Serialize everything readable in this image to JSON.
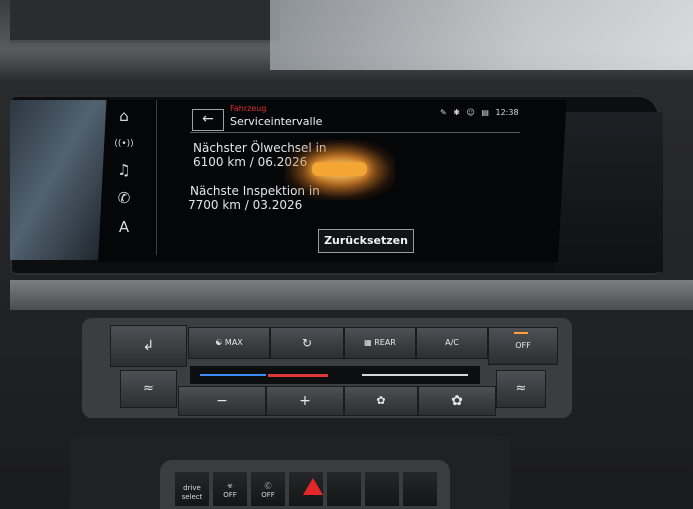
{
  "screen": {
    "breadcrumb": "Fahrzeug",
    "title": "Serviceintervalle",
    "time": "12:38",
    "oil_change_label": "Nächster Ölwechsel in",
    "oil_change_value": "6100 km / 06.2026",
    "inspection_label": "Nächste Inspektion in",
    "inspection_value": "7700 km / 03.2026",
    "reset_label": "Zurücksetzen",
    "sidebar": [
      {
        "icon": "home-icon",
        "glyph": "⌂"
      },
      {
        "icon": "radio-icon",
        "glyph": "((•))"
      },
      {
        "icon": "music-icon",
        "glyph": "♫"
      },
      {
        "icon": "phone-icon",
        "glyph": "✆"
      },
      {
        "icon": "navigation-icon",
        "glyph": "A"
      }
    ],
    "status_icons": [
      "message-icon",
      "bluetooth-icon",
      "user-icon",
      "signal-icon"
    ]
  },
  "climate": {
    "max_label": "MAX",
    "rear_label": "REAR",
    "ac_label": "A/C",
    "off_label": "OFF",
    "minus_label": "−",
    "plus_label": "+"
  },
  "console": {
    "drive_select_label": "drive select",
    "off_label_1": "OFF",
    "off_label_2": "OFF"
  }
}
